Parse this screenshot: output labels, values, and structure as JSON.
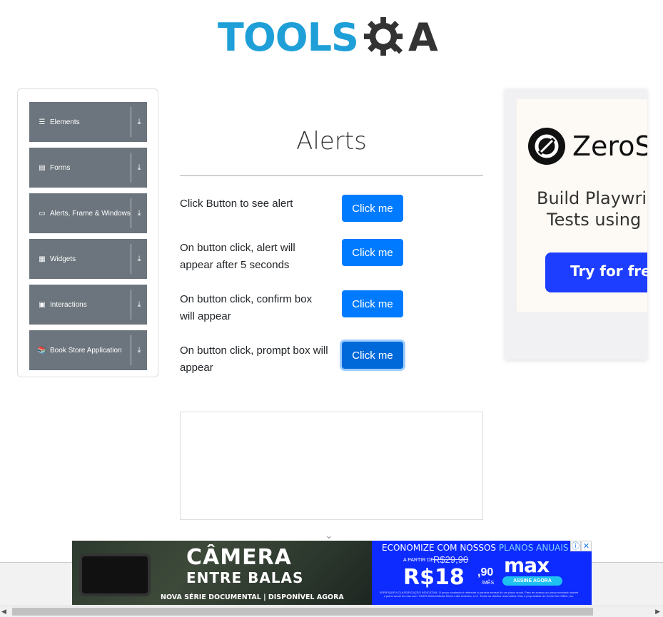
{
  "logo": {
    "part1": "TOOLS",
    "part2": "A",
    "icon": "gear-magnifier-icon"
  },
  "sidebar": {
    "groups": [
      {
        "label": "Elements",
        "icon": "hamburger-icon",
        "glyph": "☰",
        "arrow": "⤓"
      },
      {
        "label": "Forms",
        "icon": "form-icon",
        "glyph": "▤",
        "arrow": "⤓"
      },
      {
        "label": "Alerts, Frame & Windows",
        "icon": "window-icon",
        "glyph": "▭",
        "arrow": "⤓"
      },
      {
        "label": "Widgets",
        "icon": "grid-icon",
        "glyph": "▦",
        "arrow": "⤓"
      },
      {
        "label": "Interactions",
        "icon": "interactions-icon",
        "glyph": "▣",
        "arrow": "⤓"
      },
      {
        "label": "Book Store Application",
        "icon": "book-icon",
        "glyph": "📚",
        "arrow": "⤓"
      }
    ]
  },
  "main": {
    "title": "Alerts",
    "rows": [
      {
        "text": "Click Button to see alert",
        "button": "Click me"
      },
      {
        "text": "On button click, alert will appear after 5 seconds",
        "button": "Click me"
      },
      {
        "text": "On button click, confirm box will appear",
        "button": "Click me"
      },
      {
        "text": "On button click, prompt box will appear",
        "button": "Click me"
      }
    ],
    "chevron": "⌄"
  },
  "ad_right": {
    "brand": "ZeroSt",
    "tagline_line1": "Build Playwri",
    "tagline_line2": "Tests using",
    "cta": "Try for free →"
  },
  "ad_bottom": {
    "title1": "CÂMERA",
    "title2": "ENTRE BALAS",
    "subtitle": "NOVA SÉRIE DOCUMENTAL | DISPONÍVEL AGORA",
    "promo_prefix": "ECONOMIZE COM NOSSOS ",
    "promo_highlight": "PLANOS ANUAIS",
    "from": "A PARTIR DE",
    "old_price": "R$29,90",
    "price": "R$18",
    "cents": ",90",
    "per_month": "/MÊS",
    "brand": "max",
    "cta": "ASSINE AGORA",
    "fine_print": "VERIFIQUE A CLASSIFICAÇÃO INDICATIVA. O preço mostrado é referente a parcela mensal de um plano anual. Para ter acesso ao preço mostrado assine o plano anual do max.com. ©2025 WarnerMedia Direct Latin America, LLC. Todos os direitos reservados. Max é propriedade de Home Box Office, Inc.",
    "info_glyph": "ⓘ",
    "close_glyph": "✕"
  },
  "scrollbar": {
    "left": "◀",
    "right": "▶"
  },
  "colors": {
    "primary": "#007bff",
    "sidebar": "#6c757d",
    "logo_blue": "#1e9fd8",
    "ad_blue": "#0d2bff"
  }
}
